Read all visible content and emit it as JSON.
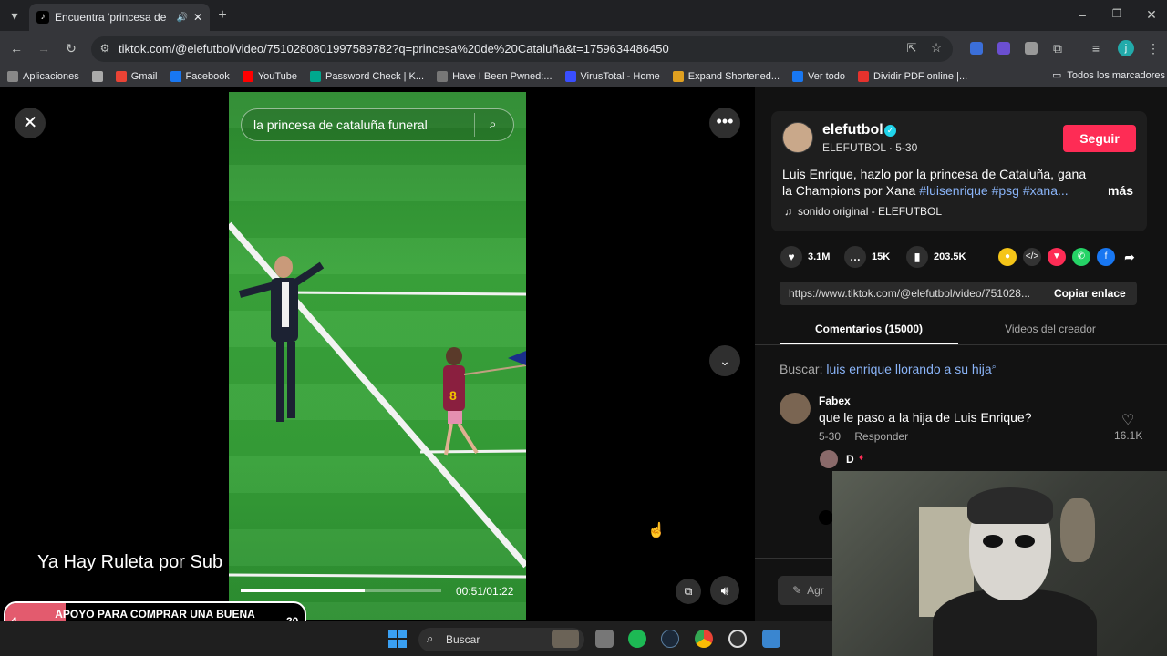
{
  "browser": {
    "tab_title": "Encuentra 'princesa de Cata",
    "url": "tiktok.com/@elefutbol/video/7510280801997589782?q=princesa%20de%20Cataluña&t=1759634486450",
    "bookmarks": [
      {
        "label": "Aplicaciones",
        "icon": "apps-grid-icon",
        "color": "#888888"
      },
      {
        "label": "",
        "icon": "grid-icon",
        "color": "#aaaaaa"
      },
      {
        "label": "Gmail",
        "icon": "gmail-icon",
        "color": "#ea4335"
      },
      {
        "label": "Facebook",
        "icon": "facebook-icon",
        "color": "#1877f2"
      },
      {
        "label": "YouTube",
        "icon": "youtube-icon",
        "color": "#ff0000"
      },
      {
        "label": "Password Check | K...",
        "icon": "kaspersky-icon",
        "color": "#00a88e"
      },
      {
        "label": "Have I Been Pwned:...",
        "icon": "hibp-icon",
        "color": "#777777"
      },
      {
        "label": "VirusTotal - Home",
        "icon": "virustotal-icon",
        "color": "#394eff"
      },
      {
        "label": "Expand Shortened...",
        "icon": "expand-icon",
        "color": "#e0a020"
      },
      {
        "label": "Ver todo",
        "icon": "facebook-icon",
        "color": "#1877f2"
      },
      {
        "label": "Dividir PDF online |...",
        "icon": "pdf-icon",
        "color": "#e5322d"
      }
    ],
    "all_bookmarks": "Todos los marcadores"
  },
  "video": {
    "search_text": "la princesa de cataluña funeral",
    "time": "00:51/01:22",
    "progress": 0.62
  },
  "author": {
    "username": "elefutbol",
    "info": "ELEFUTBOL · 5-30",
    "follow": "Seguir",
    "description_text": "Luis Enrique, hazlo por la princesa de Cataluña, gana la Champions por Xana ",
    "tags": "#luisenrique #psg #xana...",
    "more": "más",
    "sound": "sonido original - ELEFUTBOL"
  },
  "stats": {
    "likes": "3.1M",
    "comments": "15K",
    "saves": "203.5K"
  },
  "share_link": {
    "url": "https://www.tiktok.com/@elefutbol/video/751028...",
    "copy": "Copiar enlace"
  },
  "tabs": {
    "comments": "Comentarios (15000)",
    "creator": "Videos del creador"
  },
  "search_query": {
    "label": "Buscar: ",
    "query": "luis enrique llorando a su hija"
  },
  "comment": {
    "author": "Fabex",
    "text": "que le paso a la hija de Luis Enrique?",
    "date": "5-30",
    "reply": "Responder",
    "likes": "16.1K",
    "reply_author": "D"
  },
  "add_comment": "Agr",
  "overlay": {
    "ruleta": "Ya Hay Ruleta por Sub",
    "goal_start": "4",
    "goal_end": "20",
    "goal_text": "APOYO PARA COMPRAR UNA BUENA CAMARA",
    "goal_fraction": 0.2
  },
  "taskbar": {
    "search": "Buscar"
  },
  "colors": {
    "follow": "#fe2c55",
    "link": "#8ab4f8",
    "goal_fill": "#e35b6e"
  }
}
